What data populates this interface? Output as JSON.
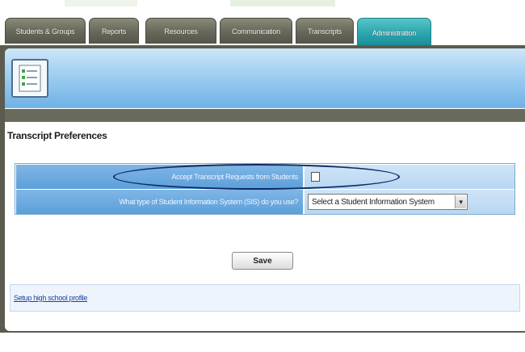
{
  "tabs": [
    {
      "label": "Students & Groups",
      "active": false
    },
    {
      "label": "Reports",
      "active": false
    },
    {
      "label": "Resources",
      "active": false
    },
    {
      "label": "Communication",
      "active": false
    },
    {
      "label": "Transcripts",
      "active": false
    },
    {
      "label": "Administration",
      "active": true
    }
  ],
  "header": {
    "icon": "document-checklist-icon"
  },
  "section": {
    "title": "Transcript Preferences"
  },
  "preferences": {
    "accept_requests": {
      "label": "Accept Transcript Requests from Students",
      "checked": false
    },
    "sis": {
      "label": "What type of Student Information System (SIS) do you use?",
      "selected": "Select a Student Information System"
    }
  },
  "actions": {
    "save_label": "Save"
  },
  "footer": {
    "setup_link": "Setup high school profile"
  },
  "colors": {
    "active_tab": "#2aa4ac",
    "inactive_tab": "#67675a",
    "header_blue": "#6fb2e6",
    "label_blue": "#5d9fd9",
    "highlight_ellipse": "#0d2a66"
  }
}
